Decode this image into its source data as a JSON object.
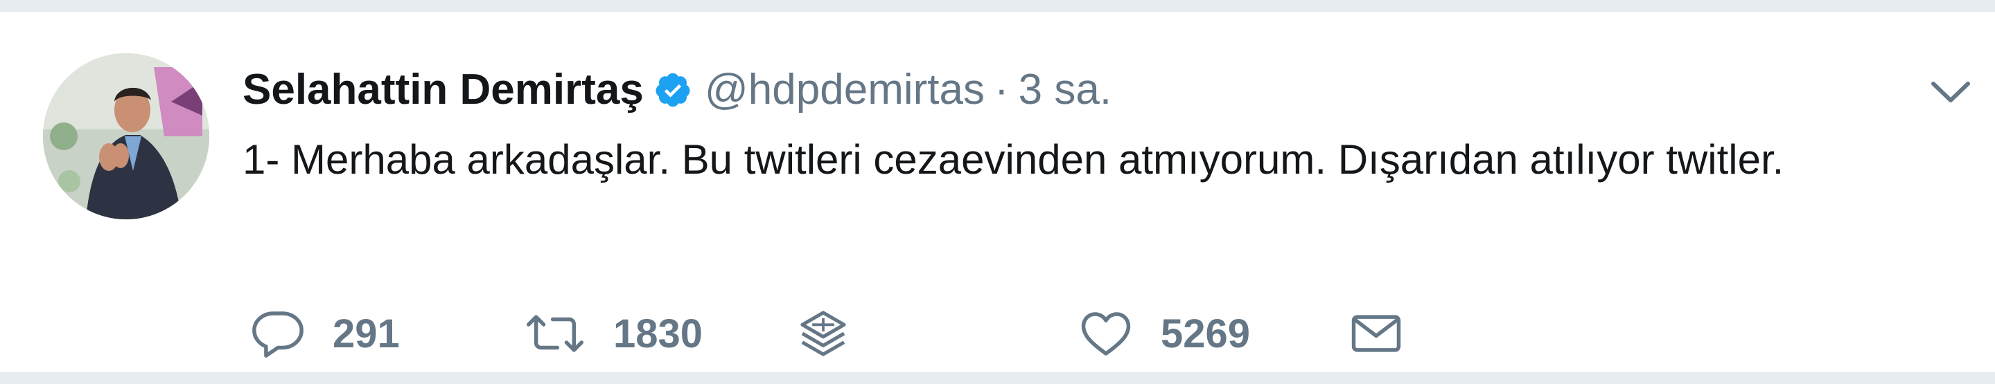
{
  "tweet": {
    "author": {
      "name": "Selahattin Demirtaş",
      "handle": "@hdpdemirtas",
      "verified": true,
      "avatar": "profile-photo"
    },
    "separator": "·",
    "time": "3 sa.",
    "text": "1- Merhaba arkadaşlar. Bu twitleri cezaevinden atmıyorum. Dışarıdan atılıyor twitler.",
    "actions": {
      "reply": {
        "icon": "reply-icon",
        "count": "291"
      },
      "retweet": {
        "icon": "retweet-icon",
        "count": "1830"
      },
      "layers": {
        "icon": "layers-icon"
      },
      "like": {
        "icon": "heart-icon",
        "count": "5269"
      },
      "dm": {
        "icon": "envelope-icon"
      }
    },
    "menu_icon": "chevron-down-icon"
  },
  "colors": {
    "verified_blue": "#1da1f2",
    "secondary_text": "#657786",
    "primary_text": "#14171a",
    "border": "#e6ecf0"
  }
}
